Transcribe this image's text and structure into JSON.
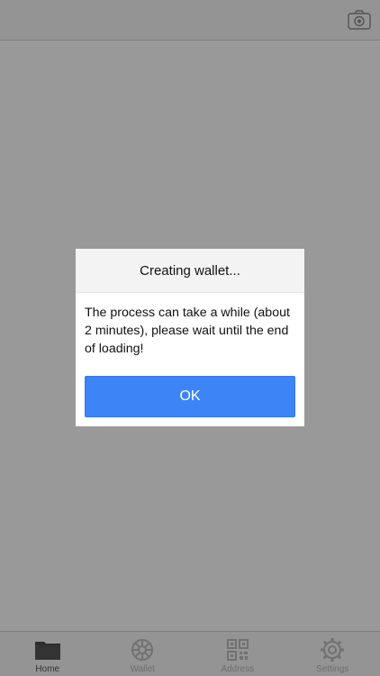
{
  "dialog": {
    "title": "Creating wallet...",
    "message": "The process can take a while (about 2 minutes), please wait until the end of loading!",
    "ok_label": "OK"
  },
  "navbar": {
    "right_icon": "camera-icon"
  },
  "tabbar": {
    "items": [
      {
        "label": "Home",
        "icon": "folder-icon",
        "active": true
      },
      {
        "label": "Wallet",
        "icon": "wallet-icon",
        "active": false
      },
      {
        "label": "Address",
        "icon": "qr-code-icon",
        "active": false
      },
      {
        "label": "Settings",
        "icon": "gear-icon",
        "active": false
      }
    ]
  },
  "colors": {
    "accent": "#3d84f7",
    "overlay": "rgba(0,0,0,0.40)"
  }
}
